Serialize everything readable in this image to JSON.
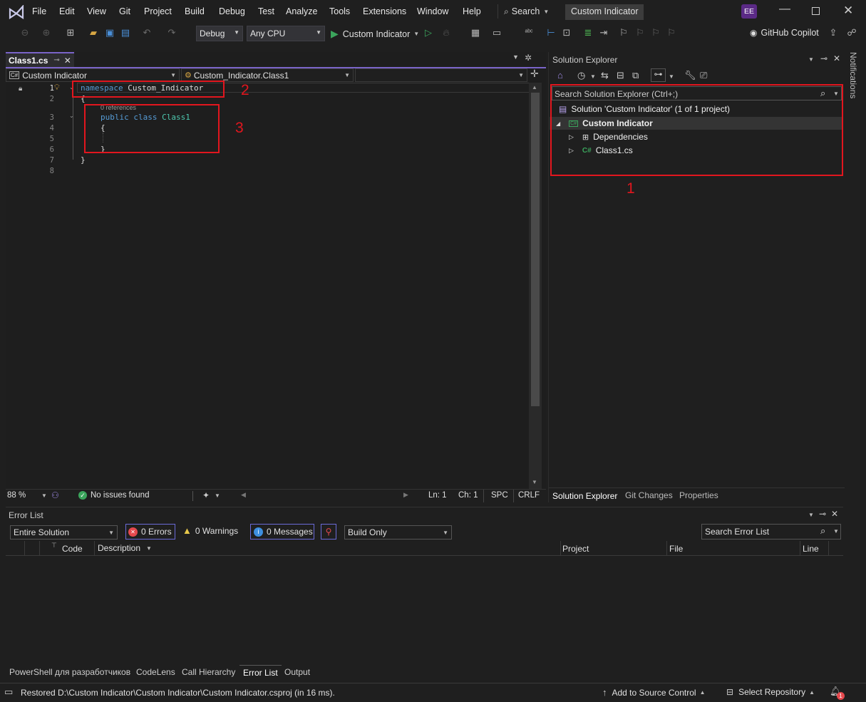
{
  "menu": [
    "File",
    "Edit",
    "View",
    "Git",
    "Project",
    "Build",
    "Debug",
    "Test",
    "Analyze",
    "Tools",
    "Extensions",
    "Window",
    "Help"
  ],
  "search_label": "Search",
  "solution_title": "Custom Indicator",
  "user_initials": "EE",
  "toolbar": {
    "config": "Debug",
    "platform": "Any CPU",
    "run_target": "Custom Indicator",
    "copilot": "GitHub Copilot"
  },
  "editor": {
    "tab_name": "Class1.cs",
    "nav_project": "Custom Indicator",
    "nav_class": "Custom_Indicator.Class1",
    "nav_member": "",
    "codelens": "0 references",
    "lines": {
      "n1": "1",
      "n2": "2",
      "n3": "3",
      "n4": "4",
      "n5": "5",
      "n6": "6",
      "n7": "7",
      "n8": "8",
      "kw_namespace": "namespace",
      "ns_name": "Custom_Indicator",
      "open1": "{",
      "kw_public": "public",
      "kw_class": "class",
      "class_name": "Class1",
      "open2": "{",
      "close2": "}",
      "close1": "}"
    },
    "zoom": "88 %",
    "issues": "No issues found",
    "ln": "Ln: 1",
    "ch": "Ch: 1",
    "spc": "SPC",
    "crlf": "CRLF"
  },
  "annotations": {
    "a1": "1",
    "a2": "2",
    "a3": "3"
  },
  "solution_explorer": {
    "title": "Solution Explorer",
    "search_placeholder": "Search Solution Explorer (Ctrl+;)",
    "solution_label": "Solution 'Custom Indicator' (1 of 1 project)",
    "project_label": "Custom Indicator",
    "dependencies": "Dependencies",
    "file": "Class1.cs",
    "tabs": [
      "Solution Explorer",
      "Git Changes",
      "Properties"
    ]
  },
  "notifications_label": "Notifications",
  "error_list": {
    "title": "Error List",
    "scope": "Entire Solution",
    "errors": "0 Errors",
    "warnings": "0 Warnings",
    "messages": "0 Messages",
    "build_filter": "Build Only",
    "search_placeholder": "Search Error List",
    "columns": {
      "code": "Code",
      "description": "Description",
      "project": "Project",
      "file": "File",
      "line": "Line"
    }
  },
  "bottom_tabs": [
    "PowerShell для разработчиков",
    "CodeLens",
    "Call Hierarchy",
    "Error List",
    "Output"
  ],
  "status": {
    "message": "Restored D:\\Custom Indicator\\Custom Indicator\\Custom Indicator.csproj (in 16 ms).",
    "source_control": "Add to Source Control",
    "repository": "Select Repository",
    "notif_count": "1"
  },
  "colors": {
    "accent": "#7a64c8",
    "annotation_red": "#e2161e",
    "keyword": "#569cd6",
    "type": "#4ec9b0",
    "success": "#3ba55c",
    "error": "#e5484d"
  }
}
